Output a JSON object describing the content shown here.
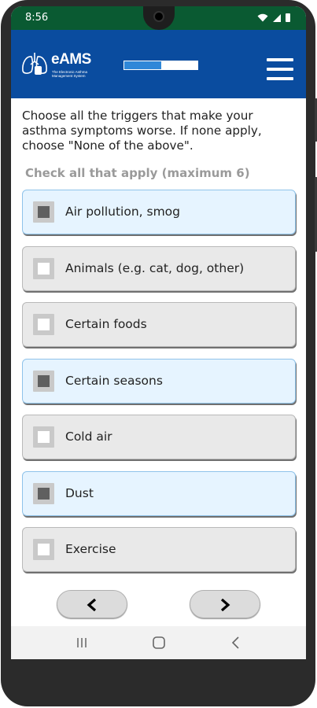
{
  "status_bar": {
    "time": "8:56",
    "icons": [
      "wifi-icon",
      "signal-icon",
      "battery-icon"
    ]
  },
  "header": {
    "logo_title": "eAMS",
    "logo_subtitle_line1": "The Electronic Asthma",
    "logo_subtitle_line2": "Management System",
    "progress_fraction": 0.5,
    "menu_icon": "hamburger-menu-icon",
    "background_color": "#0a4c9f"
  },
  "question": {
    "text": "Choose all the triggers that make your asthma symptoms worse. If none apply, choose \"None of the above\".",
    "instruction": "Check all that apply (maximum 6)"
  },
  "options": [
    {
      "label": "Air pollution, smog",
      "checked": true
    },
    {
      "label": "Animals (e.g. cat, dog, other)",
      "checked": false
    },
    {
      "label": "Certain foods",
      "checked": false
    },
    {
      "label": "Certain seasons",
      "checked": true
    },
    {
      "label": "Cold air",
      "checked": false
    },
    {
      "label": "Dust",
      "checked": true
    },
    {
      "label": "Exercise",
      "checked": false
    }
  ],
  "navigation": {
    "prev_icon": "chevron-left-icon",
    "next_icon": "chevron-right-icon"
  },
  "system_nav": {
    "icons": [
      "recent-apps-icon",
      "home-icon",
      "back-icon"
    ]
  },
  "colors": {
    "status_bar": "#0a5a32",
    "selected_option_bg": "#e6f4ff",
    "unselected_option_bg": "#e9e9e9",
    "progress_fill": "#2f87d8"
  }
}
